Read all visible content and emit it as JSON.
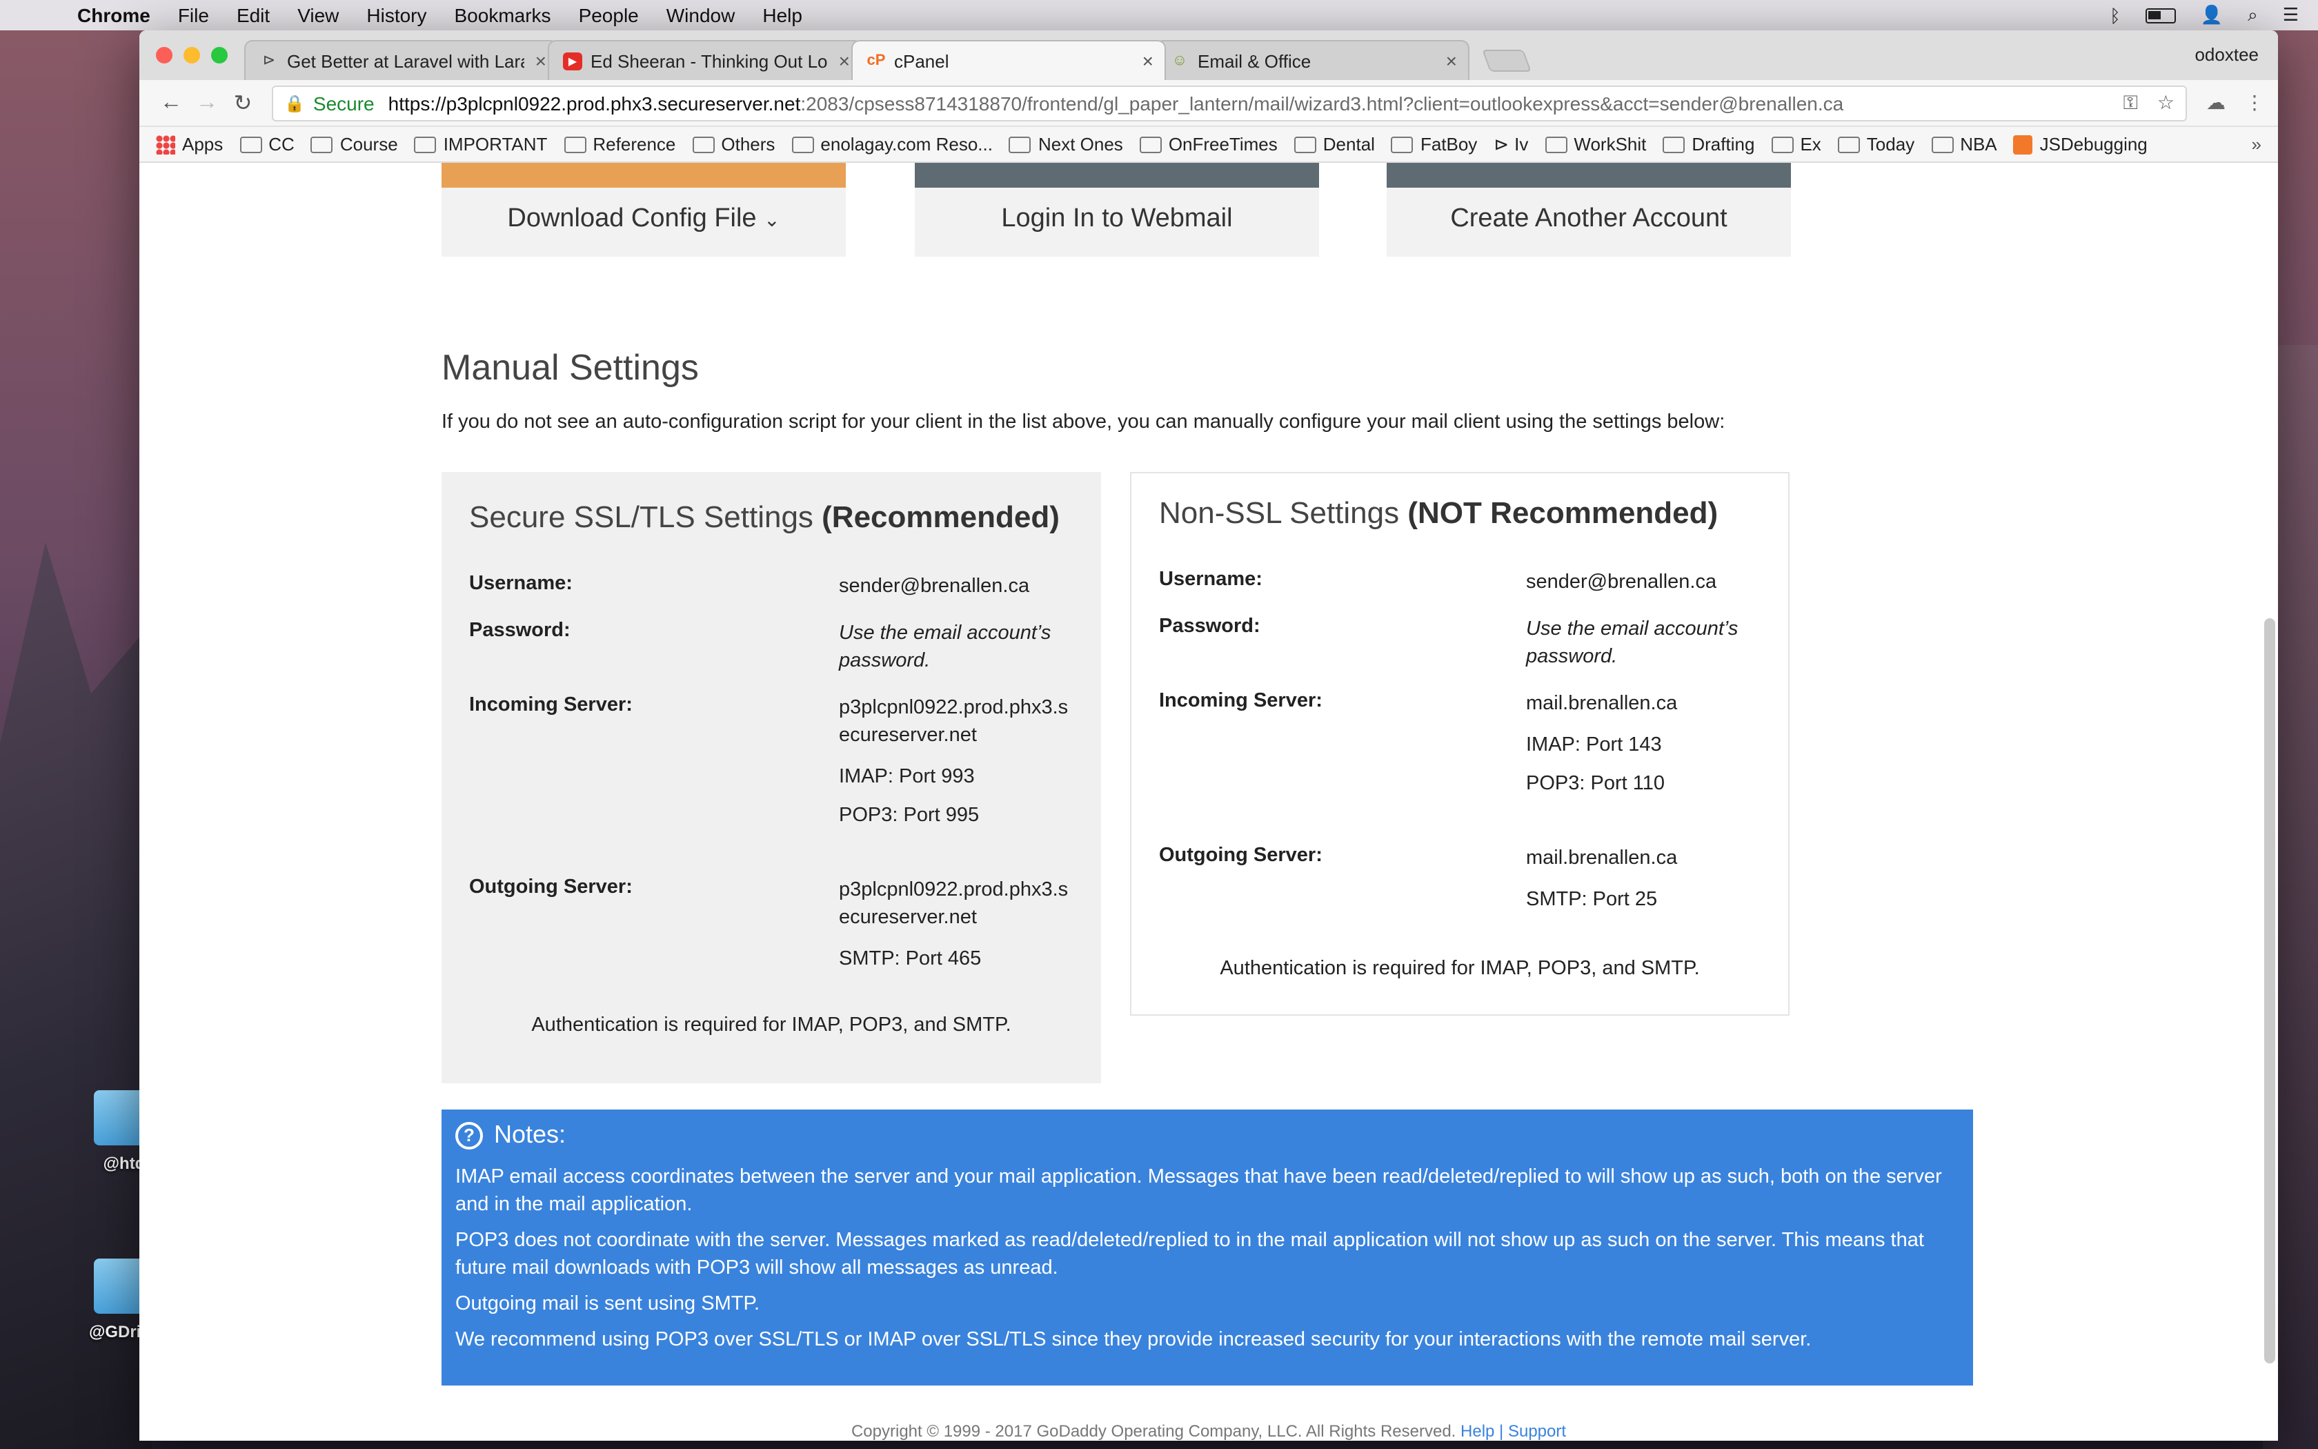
{
  "menubar": {
    "app": "Chrome",
    "items": [
      "File",
      "Edit",
      "View",
      "History",
      "Bookmarks",
      "People",
      "Window",
      "Help"
    ]
  },
  "desktop": {
    "icons": [
      "@htd",
      "@GDrive"
    ]
  },
  "browser": {
    "profile": "odoxtee",
    "tabs": [
      {
        "label": "Get Better at Laravel with Lara",
        "icon": "laravel-icon"
      },
      {
        "label": "Ed Sheeran - Thinking Out Lou",
        "icon": "youtube-icon"
      },
      {
        "label": "cPanel",
        "icon": "cpanel-icon"
      },
      {
        "label": "Email & Office",
        "icon": "godaddy-icon"
      }
    ],
    "address": {
      "secure_label": "Secure",
      "host": "https://p3plcpnl0922.prod.phx3.secureserver.net",
      "path": ":2083/cpsess8714318870/frontend/gl_paper_lantern/mail/wizard3.html?client=outlookexpress&acct=sender@brenallen.ca"
    },
    "bookmarks": [
      "Apps",
      "CC",
      "Course",
      "IMPORTANT",
      "Reference",
      "Others",
      "enolagay.com Reso...",
      "Next Ones",
      "OnFreeTimes",
      "Dental",
      "FatBoy",
      "Iv",
      "WorkShit",
      "Drafting",
      "Ex",
      "Today",
      "NBA",
      "JSDebugging"
    ],
    "bookmarks_more": "»"
  },
  "page": {
    "buttons": {
      "download": "Download Config File",
      "webmail": "Login In to Webmail",
      "another": "Create Another Account"
    },
    "manual_title": "Manual Settings",
    "intro": "If you do not see an auto-configuration script for your client in the list above, you can manually configure your mail client using the settings below:",
    "ssl": {
      "title_light": "Secure SSL/TLS Settings ",
      "title_bold": "(Recommended)",
      "username_label": "Username:",
      "username": "sender@brenallen.ca",
      "password_label": "Password:",
      "password": "Use the email account’s password.",
      "incoming_label": "Incoming Server:",
      "incoming": "p3plcpnl0922.prod.phx3.secureserver.net",
      "imap": "IMAP: Port 993",
      "pop3": "POP3: Port 995",
      "outgoing_label": "Outgoing Server:",
      "outgoing": "p3plcpnl0922.prod.phx3.secureserver.net",
      "smtp": "SMTP: Port 465",
      "auth": "Authentication is required for IMAP, POP3, and SMTP."
    },
    "nonssl": {
      "title_light": "Non-SSL Settings ",
      "title_bold": "(NOT Recommended)",
      "username_label": "Username:",
      "username": "sender@brenallen.ca",
      "password_label": "Password:",
      "password": "Use the email account’s password.",
      "incoming_label": "Incoming Server:",
      "incoming": "mail.brenallen.ca",
      "imap": "IMAP: Port 143",
      "pop3": "POP3: Port 110",
      "outgoing_label": "Outgoing Server:",
      "outgoing": "mail.brenallen.ca",
      "smtp": "SMTP: Port 25",
      "auth": "Authentication is required for IMAP, POP3, and SMTP."
    },
    "notes": {
      "title": "Notes:",
      "items": [
        "IMAP email access coordinates between the server and your mail application. Messages that have been read/deleted/replied to will show up as such, both on the server and in the mail application.",
        "POP3 does not coordinate with the server. Messages marked as read/deleted/replied to in the mail application will not show up as such on the server. This means that future mail downloads with POP3 will show all messages as unread.",
        "Outgoing mail is sent using SMTP.",
        "We recommend using POP3 over SSL/TLS or IMAP over SSL/TLS since they provide increased security for your interactions with the remote mail server."
      ]
    },
    "footer": {
      "copyright": "Copyright © 1999 - 2017 GoDaddy Operating Company, LLC. All Rights Reserved.",
      "links": "Help | Support"
    }
  },
  "colors": {
    "download_accent": "#e8a055",
    "dark_accent": "#5f6b73",
    "notes_bg": "#3983dd",
    "secure_green": "#1a8a2f"
  }
}
